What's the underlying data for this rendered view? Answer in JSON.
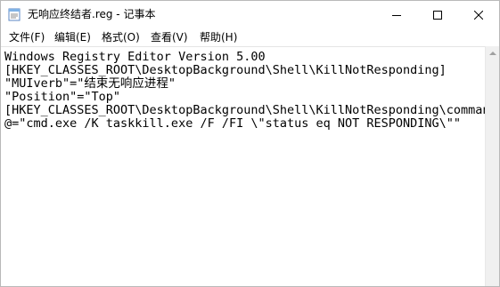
{
  "window": {
    "title": "无响应终结者.reg - 记事本"
  },
  "menu": [
    {
      "label": "文件(F)"
    },
    {
      "label": "编辑(E)"
    },
    {
      "label": "格式(O)"
    },
    {
      "label": "查看(V)"
    },
    {
      "label": "帮助(H)"
    }
  ],
  "editor": {
    "lines": [
      "Windows Registry Editor Version 5.00",
      "[HKEY_CLASSES_ROOT\\DesktopBackground\\Shell\\KillNotResponding]",
      "\"MUIverb\"=\"结束无响应进程\"",
      "\"Position\"=\"Top\"",
      "[HKEY_CLASSES_ROOT\\DesktopBackground\\Shell\\KillNotResponding\\command]",
      "@=\"cmd.exe /K taskkill.exe /F /FI \\\"status eq NOT RESPONDING\\\"\""
    ]
  },
  "colors": {
    "titlebar": "#ffffff",
    "scrollbar": "#f0f0f0"
  }
}
